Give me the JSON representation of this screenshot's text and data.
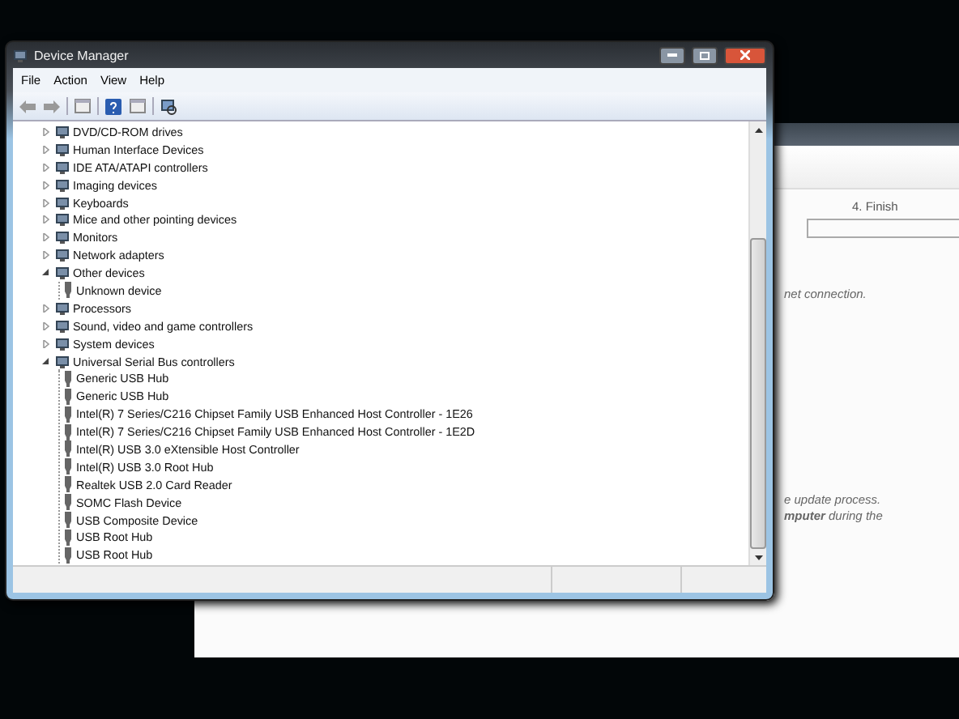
{
  "background_window": {
    "step": "4. Finish",
    "texts": [
      "net connection.",
      "e update process.",
      "**mputer** during the"
    ]
  },
  "window": {
    "title": "Device Manager"
  },
  "menu": [
    "File",
    "Action",
    "View",
    "Help"
  ],
  "tree": [
    {
      "label": "DVD/CD-ROM drives",
      "expanded": false
    },
    {
      "label": "Human Interface Devices",
      "expanded": false
    },
    {
      "label": "IDE ATA/ATAPI controllers",
      "expanded": false
    },
    {
      "label": "Imaging devices",
      "expanded": false
    },
    {
      "label": "Keyboards",
      "expanded": false
    },
    {
      "label": "Mice and other pointing devices",
      "expanded": false
    },
    {
      "label": "Monitors",
      "expanded": false
    },
    {
      "label": "Network adapters",
      "expanded": false
    },
    {
      "label": "Other devices",
      "expanded": true,
      "children": [
        {
          "label": "Unknown device"
        }
      ]
    },
    {
      "label": "Processors",
      "expanded": false
    },
    {
      "label": "Sound, video and game controllers",
      "expanded": false
    },
    {
      "label": "System devices",
      "expanded": false
    },
    {
      "label": "Universal Serial Bus controllers",
      "expanded": true,
      "children": [
        {
          "label": "Generic USB Hub"
        },
        {
          "label": "Generic USB Hub"
        },
        {
          "label": "Intel(R) 7 Series/C216 Chipset Family USB Enhanced Host Controller - 1E26"
        },
        {
          "label": "Intel(R) 7 Series/C216 Chipset Family USB Enhanced Host Controller - 1E2D"
        },
        {
          "label": "Intel(R) USB 3.0 eXtensible Host Controller"
        },
        {
          "label": "Intel(R) USB 3.0 Root Hub"
        },
        {
          "label": "Realtek USB 2.0 Card Reader"
        },
        {
          "label": "SOMC Flash Device"
        },
        {
          "label": "USB Composite Device"
        },
        {
          "label": "USB Root Hub"
        },
        {
          "label": "USB Root Hub"
        }
      ]
    }
  ]
}
